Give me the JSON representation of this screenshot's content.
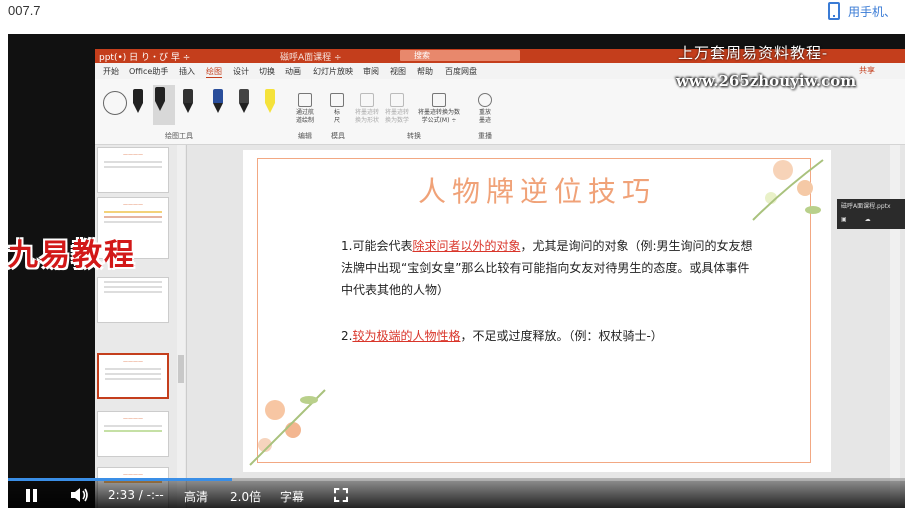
{
  "page": {
    "number_label": "007.7",
    "phone_link": "用手机、"
  },
  "watermarks": {
    "top_line": "上万套周易资料教程-",
    "url": "www.265zhouyiw.com",
    "brand": "九易教程"
  },
  "ppt": {
    "title_left": "ppt(•) 日 り・び 早 ÷",
    "title_center": "磁呼A面课程 ÷",
    "search_placeholder": "搜索",
    "menu": [
      "开始",
      "Office助手",
      "插入",
      "绘图",
      "设计",
      "切换",
      "动画",
      "幻灯片放映",
      "审阅",
      "视图",
      "帮助",
      "百度网盘"
    ],
    "active_menu": "绘图",
    "share": "共享",
    "ribbon": {
      "group_draw_label": "绘图工具",
      "eraser_btn": "通过航\n道绘制",
      "ruler_btn": "标\n尺",
      "convert1": "将墨迹转\n换为形状",
      "convert2": "将墨迹转\n换为数学",
      "convert3": "将墨迹转换为数\n学公式(M) ÷",
      "replay": "重放\n墨迹",
      "group_convert": "编辑",
      "group_stencils": "模具",
      "group_tools": "转换",
      "group_replay": "重播"
    },
    "slide": {
      "title": "人物牌逆位技巧",
      "p1_prefix": "1.可能会代表",
      "p1_highlight": "除求问者以外的对象",
      "p1_suffix": "，尤其是询问的对象（例:男生询问的女友想法牌中出现“宝剑女皇”那么比较有可能指向女友对待男生的态度。或具体事件中代表其他的人物）",
      "p2_prefix": "2.",
      "p2_highlight": "较为极端的人物性格",
      "p2_suffix": "，不足或过度释放。（例：权杖骑士-）"
    },
    "side_panel_title": "磁呼A面课程.pptx"
  },
  "player": {
    "progress": 0.25,
    "time": "2:33 / -:--",
    "quality": "高清",
    "speed": "2.0倍",
    "subtitle": "字幕",
    "accent": "#3a8ee6"
  }
}
